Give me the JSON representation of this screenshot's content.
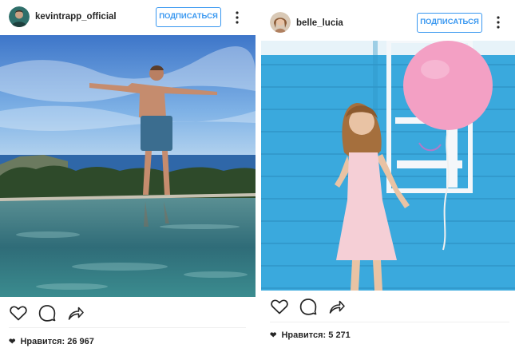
{
  "posts": [
    {
      "username": "kevintrapp_official",
      "follow_label": "ПОДПИСАТЬСЯ",
      "likes_label": "Нравится:",
      "likes_count": "26 967"
    },
    {
      "username": "belle_lucia",
      "follow_label": "ПОДПИСАТЬСЯ",
      "likes_label": "Нравится:",
      "likes_count": "5 271"
    }
  ],
  "icons": {
    "like": "heart-outline-icon",
    "comment": "speech-bubble-icon",
    "share": "share-arrow-icon",
    "more": "vertical-ellipsis-icon",
    "likes_heart": "filled-heart-icon"
  },
  "colors": {
    "accent": "#3897f0",
    "text": "#262626",
    "icon": "#262626",
    "divider": "#efefef"
  }
}
